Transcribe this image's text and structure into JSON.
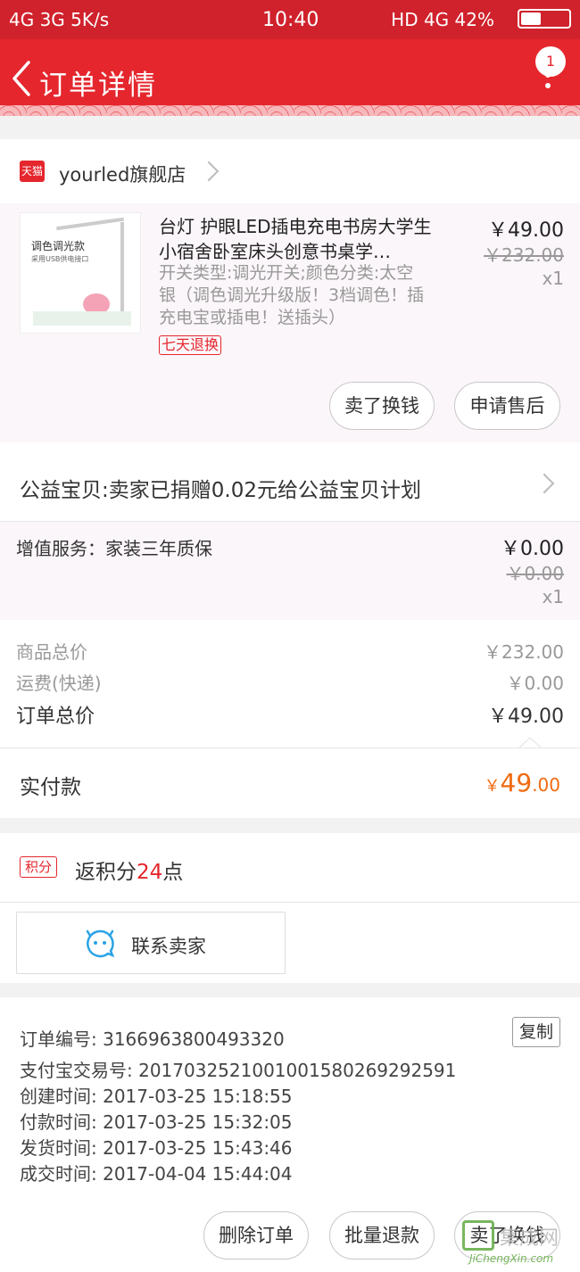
{
  "status_bar": {
    "left": "4G 3G 5K/s",
    "time": "10:40",
    "right": "HD 4G 42%"
  },
  "header": {
    "title": "订单详情",
    "badge_count": "1"
  },
  "shop": {
    "badge": "天猫",
    "name": "yourled旗舰店"
  },
  "product": {
    "thumb_title": "调色调光款",
    "thumb_sub": "采用USB供电接口",
    "title": "台灯 护眼LED插电充电书房大学生小宿舍卧室床头创意书桌学…",
    "sku": "开关类型:调光开关;颜色分类:太空银（调色调光升级版！3档调色！插充电宝或插电！送插头）",
    "return_tag": "七天退换",
    "price": "￥49.00",
    "original_price": "￥232.00",
    "quantity": "x1",
    "actions": [
      "卖了换钱",
      "申请售后"
    ]
  },
  "charity": {
    "text": "公益宝贝:卖家已捐赠0.02元给公益宝贝计划"
  },
  "value_added": {
    "label": "增值服务：家装三年质保",
    "price": "￥0.00",
    "original_price": "￥0.00",
    "quantity": "x1"
  },
  "totals": {
    "goods_label": "商品总价",
    "goods_value": "￥232.00",
    "shipping_label": "运费(快递)",
    "shipping_value": "￥0.00",
    "order_label": "订单总价",
    "order_value": "￥49.00"
  },
  "paid": {
    "label": "实付款",
    "currency": "￥",
    "integer": "49",
    "decimal": ".00"
  },
  "points": {
    "badge": "积分",
    "prefix": "返积分",
    "value": "24",
    "suffix": "点"
  },
  "contact": {
    "label": "联系卖家"
  },
  "order_info": {
    "copy_label": "复制",
    "lines": [
      "订单编号: 3166963800493320",
      "支付宝交易号: 2017032521001001580269292591",
      "创建时间: 2017-03-25 15:18:55",
      "付款时间: 2017-03-25 15:32:05",
      "发货时间: 2017-03-25 15:43:46",
      "成交时间: 2017-04-04 15:44:04"
    ]
  },
  "bottom_actions": [
    "删除订单",
    "批量退款",
    "卖了换钱"
  ],
  "watermark": {
    "cn": "集成网",
    "text": "JiChengXin.com"
  },
  "colors": {
    "brand_red": "#e5262d",
    "status_red": "#d0222c",
    "paid_orange": "#f06a10"
  }
}
